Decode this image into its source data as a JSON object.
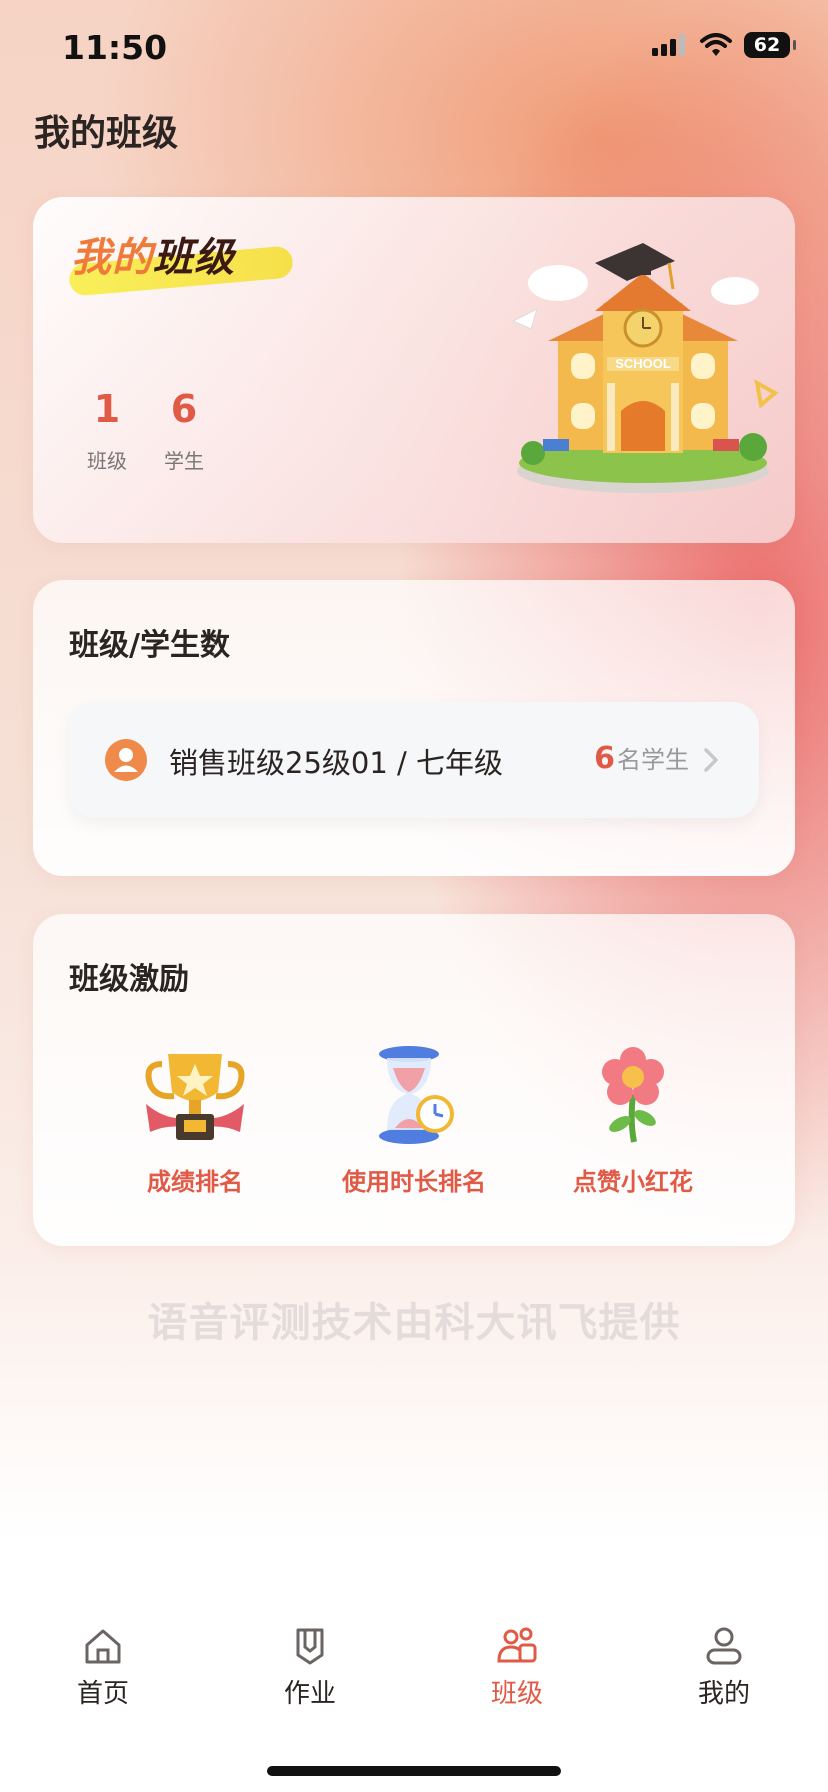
{
  "status_bar": {
    "time": "11:50",
    "battery": "62"
  },
  "page_title": "我的班级",
  "hero": {
    "logo_part1": "我的",
    "logo_part2": "班级",
    "stats": [
      {
        "value": "1",
        "label": "班级"
      },
      {
        "value": "6",
        "label": "学生"
      }
    ],
    "illustration_sign": "SCHOOL"
  },
  "classes_section": {
    "title": "班级/学生数",
    "rows": [
      {
        "name": "销售班级25级01 / 七年级",
        "count": "6",
        "count_unit": "名学生"
      }
    ]
  },
  "incentive_section": {
    "title": "班级激励",
    "items": [
      {
        "label": "成绩排名",
        "icon": "trophy-icon"
      },
      {
        "label": "使用时长排名",
        "icon": "hourglass-icon"
      },
      {
        "label": "点赞小红花",
        "icon": "flower-icon"
      }
    ]
  },
  "footer_note": "语音评测技术由科大讯飞提供",
  "tabbar": {
    "tabs": [
      {
        "label": "首页",
        "icon": "home-icon"
      },
      {
        "label": "作业",
        "icon": "homework-icon"
      },
      {
        "label": "班级",
        "icon": "class-icon",
        "active": true
      },
      {
        "label": "我的",
        "icon": "profile-icon"
      }
    ]
  },
  "colors": {
    "accent": "#e05a45",
    "avatar": "#f08a4b",
    "text": "#2a2422"
  }
}
